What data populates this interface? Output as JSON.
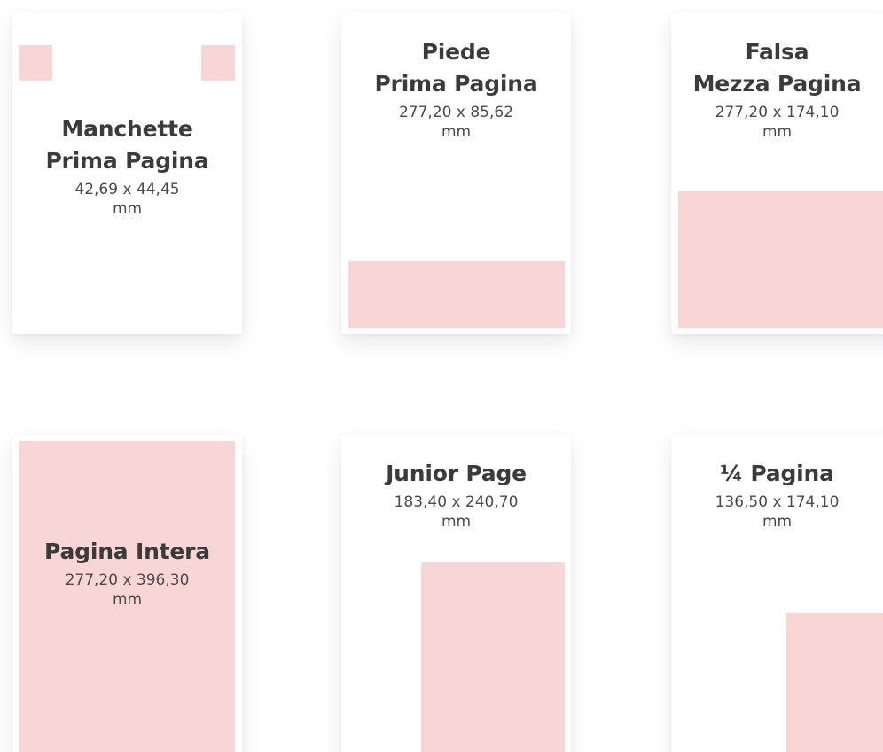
{
  "colors": {
    "accent_fill": "#f9d6d6",
    "card_background": "#ffffff",
    "title_text": "#3b3b3b",
    "dimension_text": "#4a4a4a"
  },
  "formats": [
    {
      "title_line1": "Manchette",
      "title_line2": "Prima Pagina",
      "dim_line1": "42,69 x 44,45",
      "dim_line2": "mm"
    },
    {
      "title_line1": "Piede",
      "title_line2": "Prima Pagina",
      "dim_line1": "277,20 x 85,62",
      "dim_line2": "mm"
    },
    {
      "title_line1": "Falsa",
      "title_line2": "Mezza Pagina",
      "dim_line1": "277,20 x 174,10",
      "dim_line2": "mm"
    },
    {
      "title_line1": "Pagina Intera",
      "dim_line1": "277,20 x 396,30",
      "dim_line2": "mm"
    },
    {
      "title_line1": "Junior Page",
      "dim_line1": "183,40 x 240,70",
      "dim_line2": "mm"
    },
    {
      "title_line1": "¼ Pagina",
      "dim_line1": "136,50 x 174,10",
      "dim_line2": "mm"
    }
  ]
}
